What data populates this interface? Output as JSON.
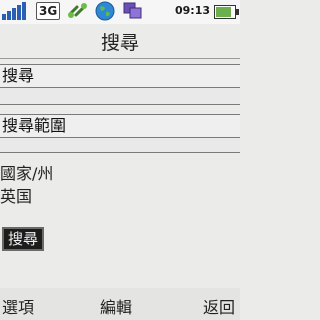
{
  "status_bar": {
    "network": "3G",
    "time": "09:13",
    "battery_level": 0.85,
    "signal_level": 5,
    "icons": [
      "signal-icon",
      "link-icon",
      "globe-icon",
      "windows-icon",
      "battery-icon"
    ]
  },
  "screen": {
    "title": "搜尋"
  },
  "form": {
    "search_label": "搜尋",
    "search_value": "",
    "scope_label": "搜尋範圍",
    "scope_value": "",
    "country_label": "國家/州",
    "country_value": "英国",
    "search_button_label": "搜尋"
  },
  "softkeys": {
    "left": "選項",
    "center": "編輯",
    "right": "返回"
  },
  "colors": {
    "background": "#ebebea",
    "signal": "#2a5fb3",
    "button_bg": "#1c1c1c"
  }
}
